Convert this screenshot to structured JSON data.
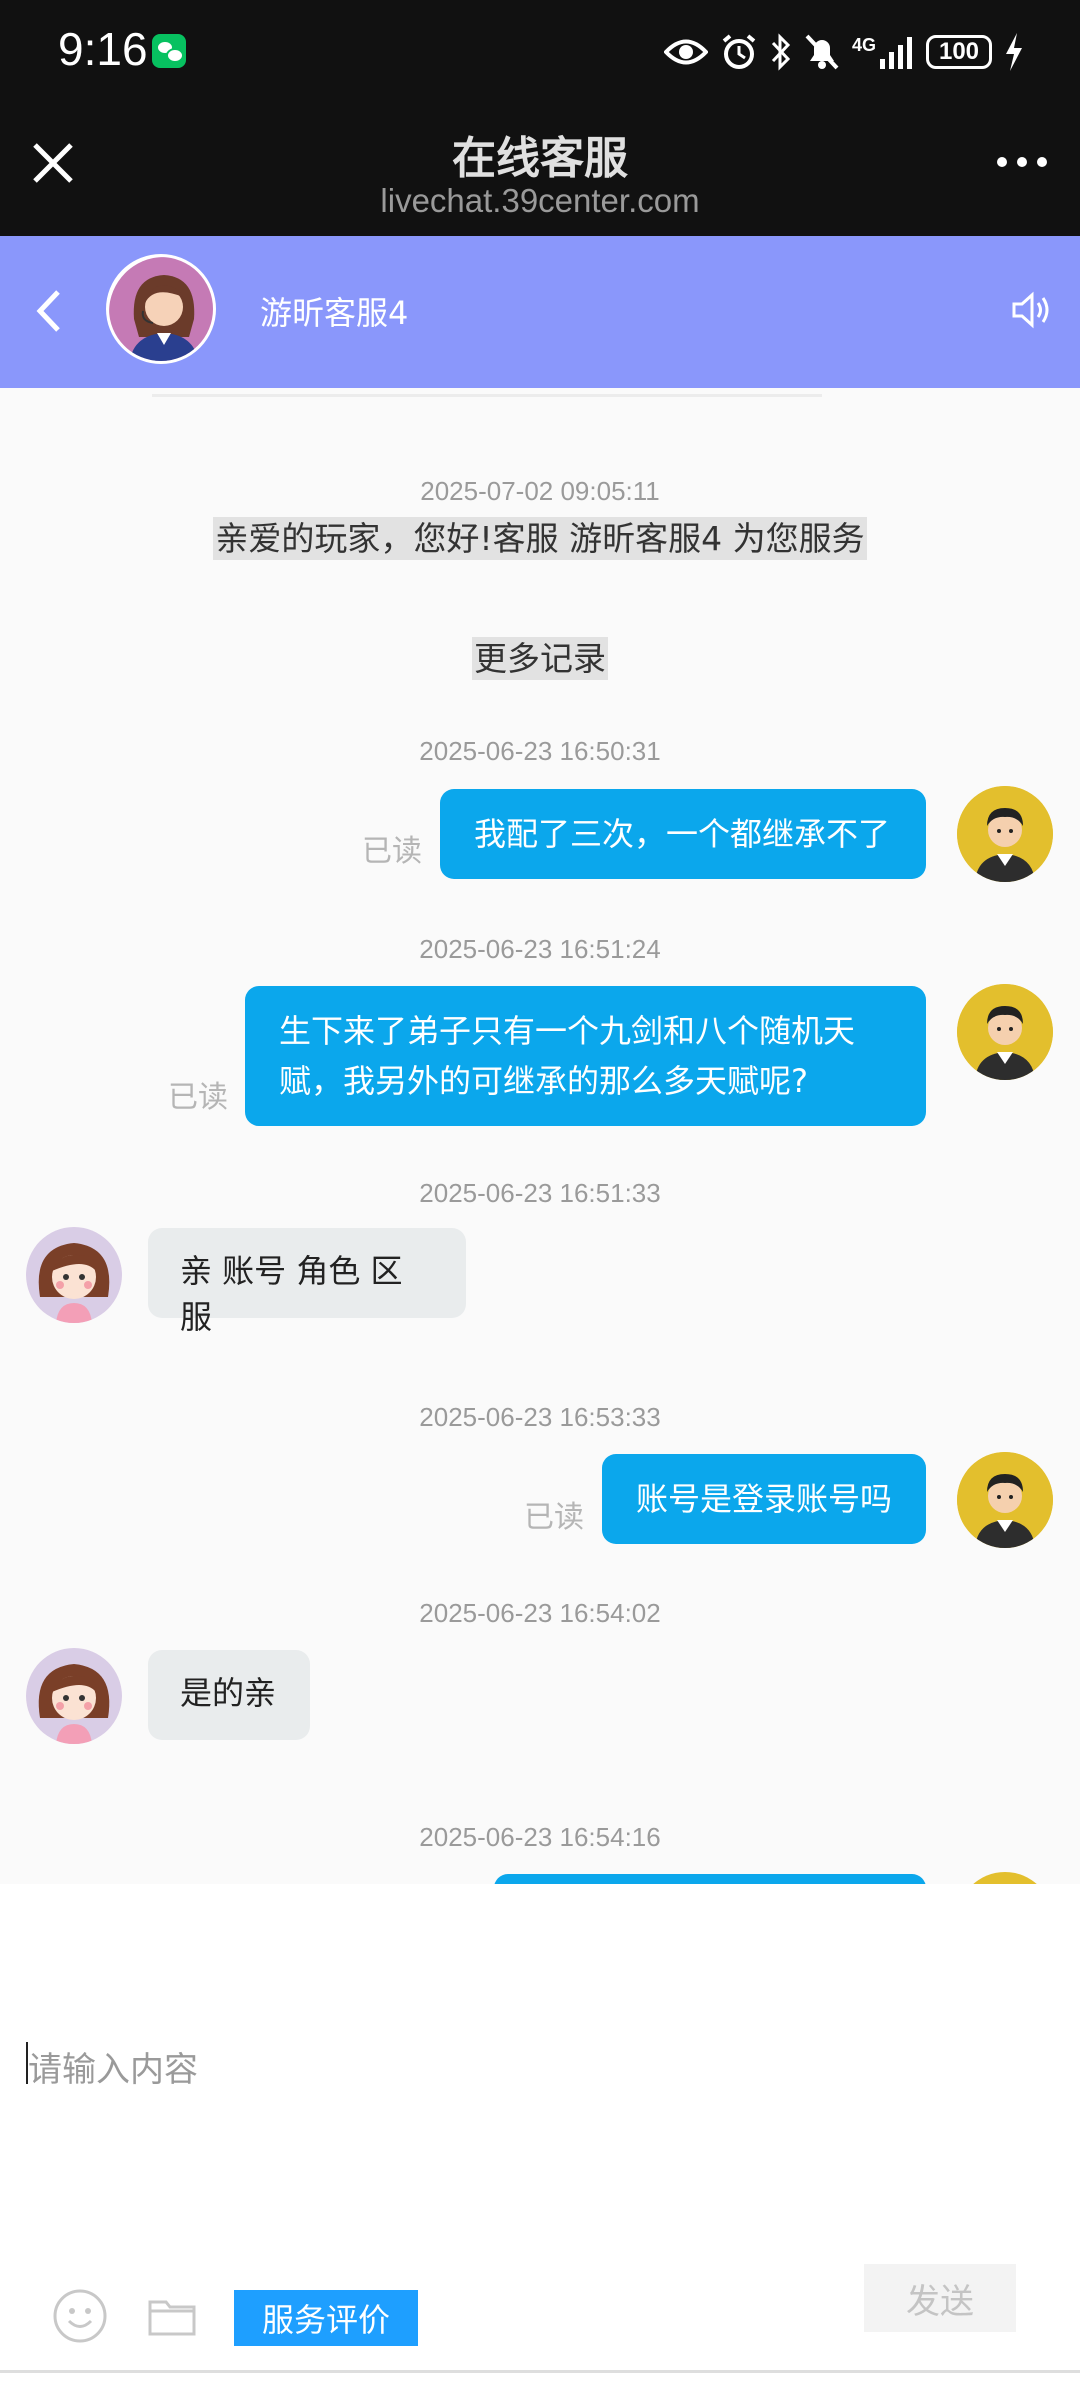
{
  "status_bar": {
    "time": "9:16",
    "battery": "100",
    "network": "4G"
  },
  "browser": {
    "title": "在线客服",
    "url": "livechat.39center.com"
  },
  "chat_header": {
    "agent_name": "游昕客服4"
  },
  "colors": {
    "header_bg": "#8a97fb",
    "user_bubble": "#0ba7ec",
    "agent_bubble": "#e9eced",
    "rate_button": "#1e9fff"
  },
  "messages": {
    "welcome_time": "2025-07-02 09:05:11",
    "welcome_text": "亲爱的玩家，您好!客服 游昕客服4 为您服务",
    "more_records": "更多记录",
    "read_label": "已读",
    "m1": {
      "time": "2025-06-23 16:50:31",
      "text": "我配了三次，一个都继承不了"
    },
    "m2": {
      "time": "2025-06-23 16:51:24",
      "line1": "生下来了弟子只有一个九剑和八个随机天",
      "line2": "赋，我另外的可继承的那么多天赋呢?"
    },
    "m3": {
      "time": "2025-06-23 16:51:33",
      "text": "亲 账号 角色 区服"
    },
    "m4": {
      "time": "2025-06-23 16:53:33",
      "text": "账号是登录账号吗"
    },
    "m5": {
      "time": "2025-06-23 16:54:02",
      "text": "是的亲"
    },
    "m6": {
      "time": "2025-06-23 16:54:16"
    }
  },
  "input": {
    "placeholder": "请输入内容",
    "rate_label": "服务评价",
    "send_label": "发送"
  },
  "icons": {
    "close": "close-icon",
    "more": "more-icon",
    "back": "chevron-left-icon",
    "sound": "speaker-icon",
    "emoji": "emoji-icon",
    "folder": "folder-icon"
  }
}
